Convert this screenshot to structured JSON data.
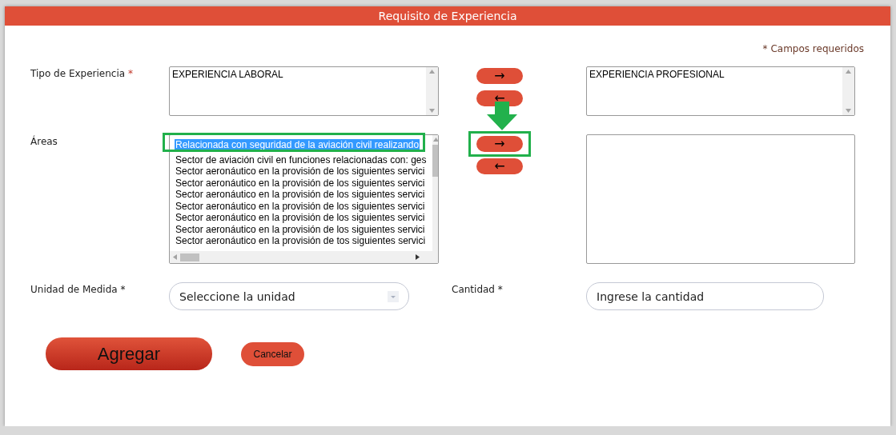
{
  "dialog": {
    "title": "Requisito de Experiencia"
  },
  "required_note": "* Campos requeridos",
  "experience_type": {
    "label": "Tipo de Experiencia",
    "required_mark": "*",
    "available": [
      {
        "text": "EXPERIENCIA LABORAL",
        "selected": false
      }
    ],
    "chosen": [
      {
        "text": "EXPERIENCIA PROFESIONAL",
        "selected": false
      }
    ],
    "move_right": "→",
    "move_left": "←"
  },
  "areas": {
    "label": "Áreas",
    "available": [
      {
        "text": "Relacionada con seguridad de la aviación civil realizando",
        "selected": true
      },
      {
        "text": "Sector de aviación civil en funciones relacionadas con: ges",
        "selected": false
      },
      {
        "text": "Sector aeronáutico en la provisión de los siguientes servici",
        "selected": false
      },
      {
        "text": "Sector aeronáutico en la provisión de los siguientes servici",
        "selected": false
      },
      {
        "text": "Sector aeronáutico en la provisión de los siguientes servici",
        "selected": false
      },
      {
        "text": "Sector aeronáutico en la provisión de los siguientes servici",
        "selected": false
      },
      {
        "text": "Sector aeronáutico en la provisión de los siguientes servici",
        "selected": false
      },
      {
        "text": "Sector aeronáutico en la provisión de los siguientes servici",
        "selected": false
      },
      {
        "text": "Sector aeronáutico en la provisión de tos siguientes servici",
        "selected": false
      }
    ],
    "move_right": "→",
    "move_left": "←"
  },
  "unit": {
    "label": "Unidad de Medida *",
    "placeholder": "Seleccione la unidad"
  },
  "quantity": {
    "label": "Cantidad *",
    "placeholder": "Ingrese la cantidad"
  },
  "buttons": [
    {
      "label": "Agregar",
      "kind": "primary"
    },
    {
      "label": "Cancelar",
      "kind": "secondary"
    }
  ]
}
